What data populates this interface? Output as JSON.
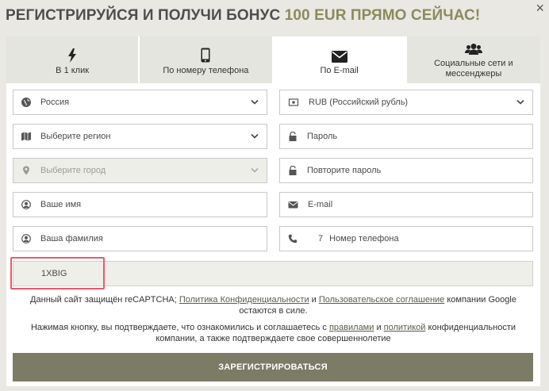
{
  "close_label": "×",
  "headline": {
    "text": "РЕГИСТРИРУЙСЯ И ПОЛУЧИ БОНУС ",
    "accent": "100 EUR ПРЯМО СЕЙЧАС!"
  },
  "tabs": [
    {
      "label": "В 1 клик",
      "icon": "lightning-icon"
    },
    {
      "label": "По номеру телефона",
      "icon": "phone-icon"
    },
    {
      "label": "По E-mail",
      "icon": "envelope-icon",
      "active": true
    },
    {
      "label": "Социальные сети и мессенджеры",
      "icon": "users-icon"
    }
  ],
  "form": {
    "country": "Россия",
    "currency": "RUB (Российский рубль)",
    "region_placeholder": "Выберите регион",
    "password_placeholder": "Пароль",
    "city_placeholder": "Выберите город",
    "password_repeat_placeholder": "Повторите пароль",
    "first_name_placeholder": "Ваше имя",
    "email_placeholder": "E-mail",
    "last_name_placeholder": "Ваша фамилия",
    "phone_code": "7",
    "phone_placeholder": "Номер телефона",
    "promo_code": "1XBIG"
  },
  "recaptcha": {
    "text1": "Данный сайт защищён reCAPTCHA; ",
    "privacy_link": "Политика Конфиденциальности",
    "and": " и ",
    "terms_link": "Пользовательское соглашение",
    "text2": " компании Google остаются в силе."
  },
  "consent": {
    "text1": "Нажимая кнопку, вы подтверждаете, что ознакомились и соглашаетесь с ",
    "rules_link": "правилами",
    "and": " и ",
    "policy_link": "политикой",
    "text2": " конфиденциальности компании, а также подтверждаете свое совершеннолетие"
  },
  "submit_label": "ЗАРЕГИСТРИРОВАТЬСЯ",
  "colors": {
    "accent": "#8b8b5b",
    "button": "#7c7b66",
    "highlight": "#e85a6a"
  }
}
